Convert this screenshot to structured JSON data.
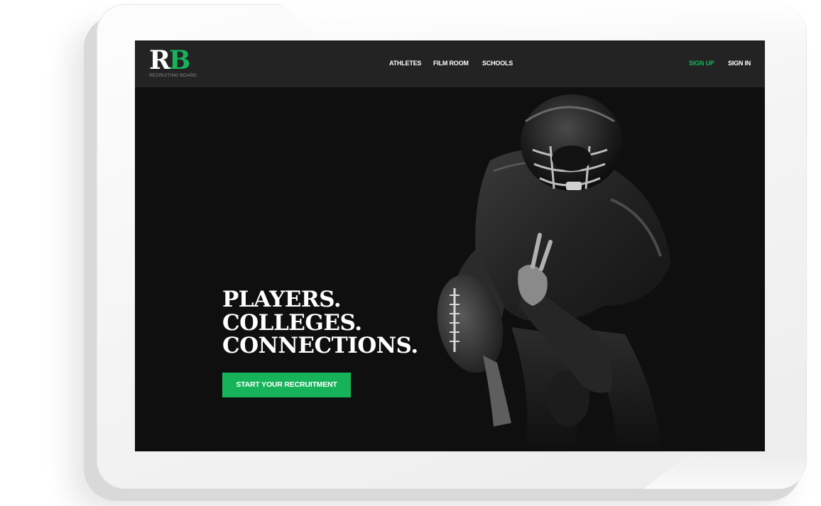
{
  "brand": {
    "logo_r": "R",
    "logo_b": "B",
    "tagline": "RECRUITING BOARD",
    "accent_color": "#17b35a"
  },
  "nav": {
    "links": [
      "ATHLETES",
      "FILM ROOM",
      "SCHOOLS"
    ],
    "sign_up": "SIGN UP",
    "sign_in": "SIGN IN"
  },
  "hero": {
    "headline": [
      "PLAYERS.",
      "COLLEGES.",
      "CONNECTIONS."
    ],
    "cta_label": "START YOUR RECRUITMENT",
    "image": "football-player-photo"
  }
}
